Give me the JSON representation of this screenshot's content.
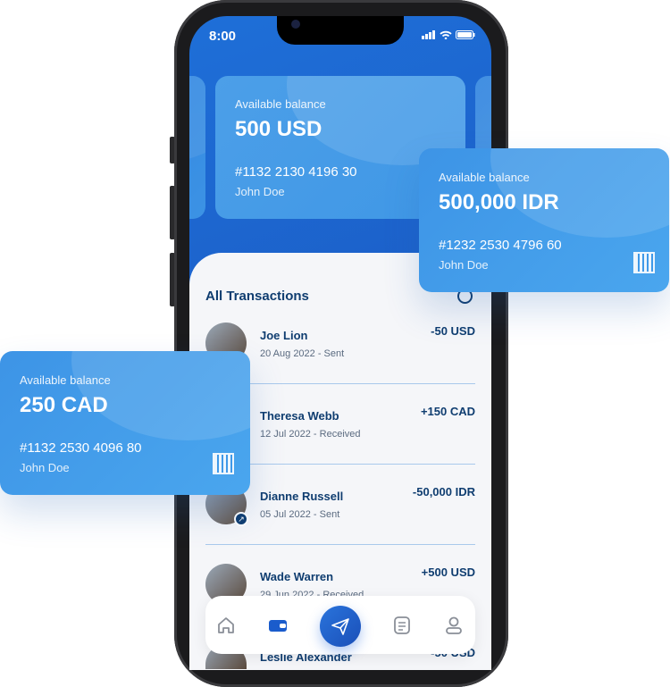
{
  "status": {
    "time": "8:00"
  },
  "cards": [
    {
      "label": "Available balance",
      "amount": "500 USD",
      "number": "#1132 2130 4196 30",
      "name": "John Doe"
    },
    {
      "label": "Available balance",
      "amount": "500,000 IDR",
      "number": "#1232 2530 4796 60",
      "name": "John Doe"
    },
    {
      "label": "Available balance",
      "amount": "250 CAD",
      "number": "#1132 2530 4096 80",
      "name": "John Doe"
    }
  ],
  "transactions_title": "All Transactions",
  "transactions": [
    {
      "name": "Joe Lion",
      "date": "20 Aug 2022 - Sent",
      "amount": "-50 USD"
    },
    {
      "name": "Theresa Webb",
      "date": "12 Jul 2022 - Received",
      "amount": "+150 CAD"
    },
    {
      "name": "Dianne Russell",
      "date": "05 Jul 2022 - Sent",
      "amount": "-50,000 IDR"
    },
    {
      "name": "Wade Warren",
      "date": "29 Jun 2022 - Received",
      "amount": "+500 USD"
    },
    {
      "name": "Leslie Alexander",
      "date": "",
      "amount": "-50 USD"
    }
  ],
  "nav": [
    "home-icon",
    "wallet-icon",
    "send-icon",
    "document-icon",
    "profile-icon"
  ],
  "colors": {
    "primary": "#1a4fb8",
    "card": "#4aa6ee",
    "text": "#0f3d70"
  }
}
